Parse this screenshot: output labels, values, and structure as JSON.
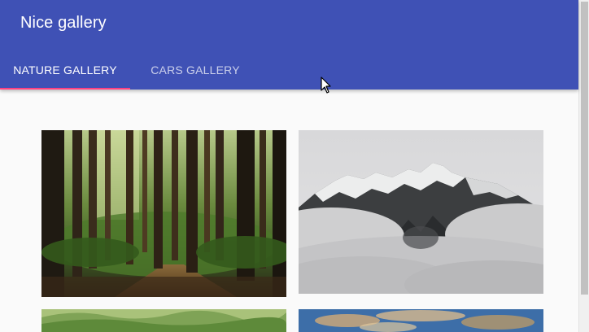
{
  "app": {
    "title": "Nice gallery"
  },
  "tabs": [
    {
      "label": "NATURE GALLERY",
      "selected": true
    },
    {
      "label": "CARS GALLERY",
      "selected": false
    }
  ],
  "theme": {
    "primary": "#3f51b5",
    "tab_indicator": "#ff4081",
    "background": "#fafafa"
  },
  "gallery": {
    "images": [
      {
        "subject": "forest"
      },
      {
        "subject": "misty-mountain"
      },
      {
        "subject": "green-hills"
      },
      {
        "subject": "sky-clouds"
      }
    ]
  }
}
